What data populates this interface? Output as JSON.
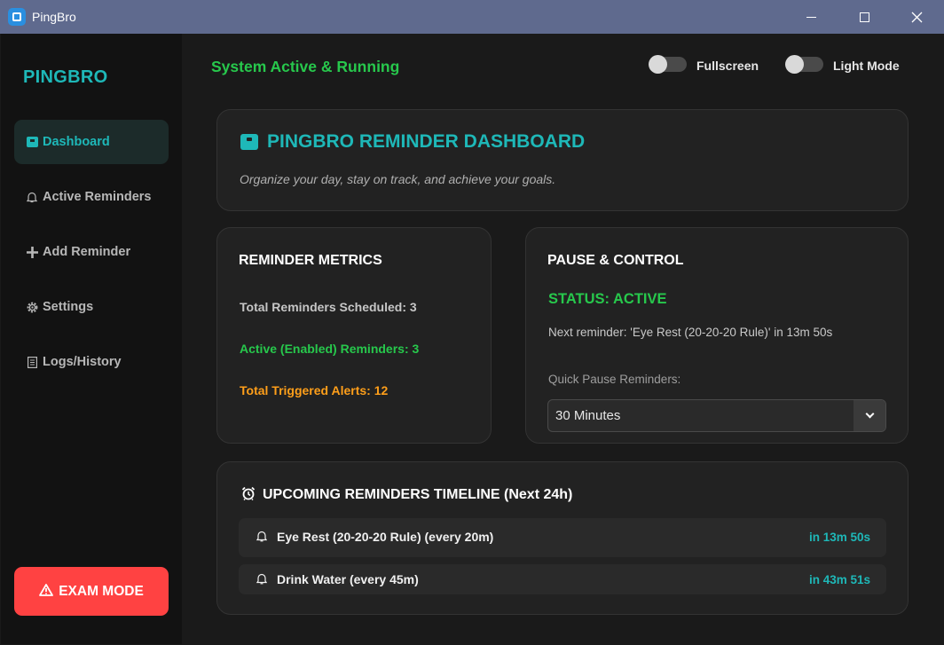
{
  "window": {
    "title": "PingBro"
  },
  "sidebar": {
    "brand": "PINGBRO",
    "items": [
      {
        "label": "Dashboard",
        "icon": "dashboard-icon",
        "active": true
      },
      {
        "label": "Active Reminders",
        "icon": "bell-icon",
        "active": false
      },
      {
        "label": "Add Reminder",
        "icon": "plus-icon",
        "active": false
      },
      {
        "label": "Settings",
        "icon": "gear-icon",
        "active": false
      },
      {
        "label": "Logs/History",
        "icon": "log-icon",
        "active": false
      }
    ],
    "exam_mode_label": "EXAM MODE"
  },
  "header": {
    "status_text": "System Active & Running",
    "fullscreen_label": "Fullscreen",
    "light_mode_label": "Light Mode",
    "fullscreen_on": false,
    "light_mode_on": false
  },
  "hero": {
    "title": "PINGBRO REMINDER DASHBOARD",
    "subtitle": "Organize your day, stay on track, and achieve your goals."
  },
  "metrics": {
    "title": "REMINDER METRICS",
    "total_scheduled": "Total Reminders Scheduled: 3",
    "active_enabled": "Active (Enabled) Reminders: 3",
    "total_triggered": "Total Triggered Alerts: 12"
  },
  "control": {
    "title": "PAUSE & CONTROL",
    "status": "STATUS: ACTIVE",
    "next_reminder": "Next reminder: 'Eye Rest (20-20-20 Rule)' in 13m 50s",
    "quick_pause_label": "Quick Pause Reminders:",
    "quick_pause_value": "30 Minutes"
  },
  "timeline": {
    "title": "UPCOMING REMINDERS TIMELINE (Next 24h)",
    "items": [
      {
        "label": "Eye Rest (20-20-20 Rule) (every 20m)",
        "time": "in 13m 50s"
      },
      {
        "label": "Drink Water (every 45m)",
        "time": "in 43m 51s"
      }
    ]
  },
  "colors": {
    "accent": "#1eb8b8",
    "success": "#27c84c",
    "warning": "#ff9f1a",
    "danger": "#ff4242",
    "titlebar": "#5f6a8e"
  }
}
